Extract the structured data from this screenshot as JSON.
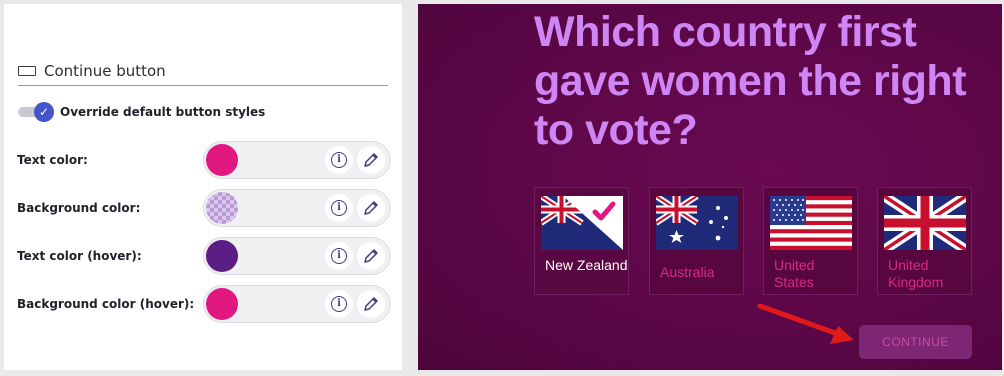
{
  "settings": {
    "section_title": "Continue button",
    "override_label": "Override default button styles",
    "override_enabled": true,
    "rows": [
      {
        "label": "Text color:",
        "color": "#e0187f"
      },
      {
        "label": "Background color:",
        "color": "transparent"
      },
      {
        "label": "Text color (hover):",
        "color": "#5a1e86"
      },
      {
        "label": "Background color (hover):",
        "color": "#e0187f"
      }
    ]
  },
  "preview": {
    "question": "Which country first gave women the right to vote?",
    "options": [
      {
        "label": "New Zealand",
        "selected": true
      },
      {
        "label": "Australia",
        "selected": false
      },
      {
        "label": "United States",
        "selected": false
      },
      {
        "label": "United Kingdom",
        "selected": false
      }
    ],
    "continue_label": "CONTINUE"
  },
  "colors": {
    "preview_bg": "#5c0747",
    "question_text": "#cf86f5",
    "option_text": "#d82a8a",
    "continue_bg": "#7d2774",
    "continue_text": "#c64d9b",
    "toggle_accent": "#4355c9",
    "annotation_arrow": "#e01a1a"
  }
}
